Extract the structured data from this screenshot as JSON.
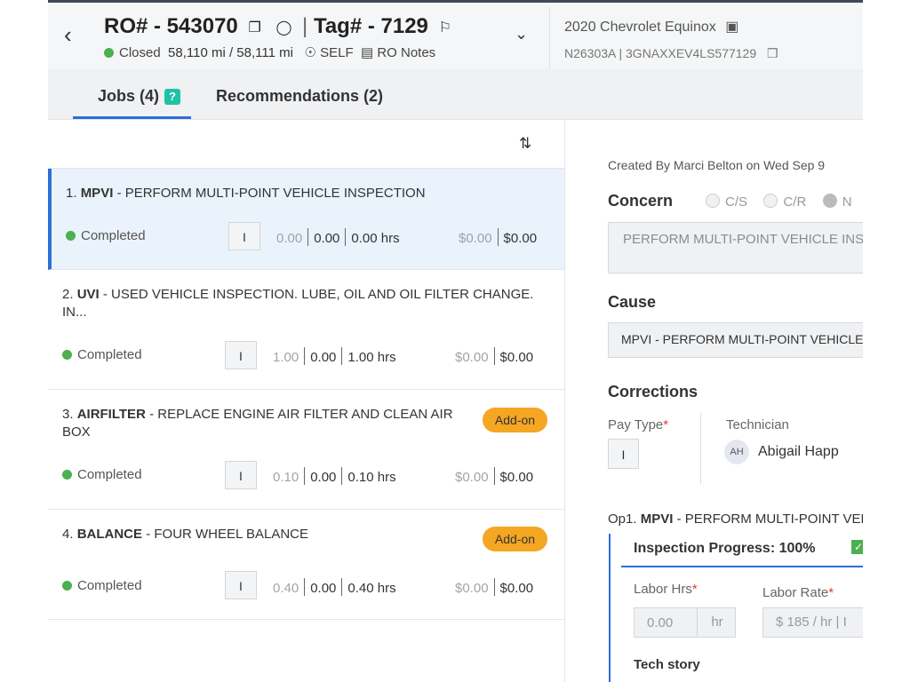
{
  "header": {
    "ro_label": "RO# - 543070",
    "tag_label": "Tag# - 7129",
    "status": "Closed",
    "mileage": "58,110 mi / 58,111 mi",
    "customer_type": "SELF",
    "ro_notes": "RO Notes",
    "vehicle": "2020 Chevrolet Equinox",
    "vin_line": "N26303A | 3GNAXXEV4LS577129"
  },
  "tabs": {
    "jobs": "Jobs (4)",
    "jobs_badge": "?",
    "recommendations": "Recommendations (2)"
  },
  "jobs": [
    {
      "num": "1.",
      "code": "MPVI",
      "desc": " - PERFORM MULTI-POINT VEHICLE INSPECTION",
      "status": "Completed",
      "pay_type": "I",
      "hrs_a": "0.00",
      "hrs_b": "0.00",
      "hrs_c": "0.00 hrs",
      "amt_a": "$0.00",
      "amt_b": "$0.00",
      "addon": ""
    },
    {
      "num": "2.",
      "code": "UVI",
      "desc": " - USED VEHICLE INSPECTION. LUBE, OIL AND OIL FILTER CHANGE. IN...",
      "status": "Completed",
      "pay_type": "I",
      "hrs_a": "1.00",
      "hrs_b": "0.00",
      "hrs_c": "1.00 hrs",
      "amt_a": "$0.00",
      "amt_b": "$0.00",
      "addon": ""
    },
    {
      "num": "3.",
      "code": "AIRFILTER",
      "desc": " - REPLACE ENGINE AIR FILTER AND CLEAN AIR BOX",
      "status": "Completed",
      "pay_type": "I",
      "hrs_a": "0.10",
      "hrs_b": "0.00",
      "hrs_c": "0.10 hrs",
      "amt_a": "$0.00",
      "amt_b": "$0.00",
      "addon": "Add-on"
    },
    {
      "num": "4.",
      "code": "BALANCE",
      "desc": " - FOUR WHEEL BALANCE",
      "status": "Completed",
      "pay_type": "I",
      "hrs_a": "0.40",
      "hrs_b": "0.00",
      "hrs_c": "0.40 hrs",
      "amt_a": "$0.00",
      "amt_b": "$0.00",
      "addon": "Add-on"
    }
  ],
  "detail": {
    "created": "Created By Marci Belton on Wed Sep 9",
    "concern_label": "Concern",
    "concern_options": [
      "C/S",
      "C/R",
      "N"
    ],
    "concern_text": "PERFORM MULTI-POINT VEHICLE INSPECTION",
    "cause_label": "Cause",
    "cause_text": "MPVI - PERFORM MULTI-POINT VEHICLE INSPECTION",
    "corrections_label": "Corrections",
    "pay_type_label": "Pay Type",
    "pay_type_value": "I",
    "technician_label": "Technician",
    "tech_initials": "AH",
    "tech_name": "Abigail Happ",
    "op_prefix": "Op1.",
    "op_code": "MPVI",
    "op_desc": " - PERFORM MULTI-POINT VEHICLE INSPECTION",
    "inspection_progress": "Inspection Progress: 100%",
    "labor_hrs_label": "Labor Hrs",
    "labor_hrs_value": "0.00",
    "labor_hrs_unit": "hr",
    "labor_rate_label": "Labor Rate",
    "labor_rate_value": "$ 185 / hr | I",
    "tech_story_label": "Tech story"
  },
  "colors": {
    "accent": "#2c6fd6",
    "status_green": "#4caf50",
    "addon_orange": "#f5a623",
    "badge_teal": "#20c2a6"
  }
}
